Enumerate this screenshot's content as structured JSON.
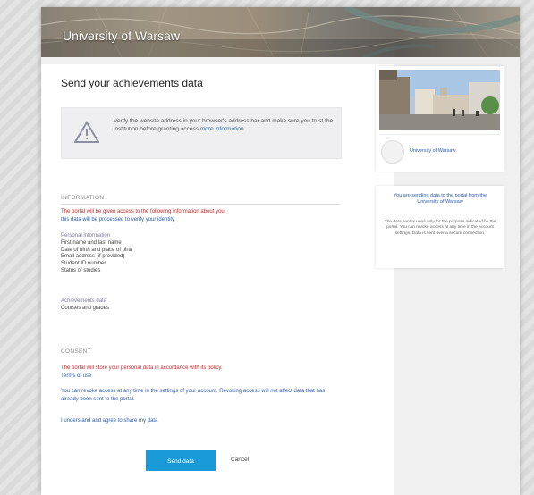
{
  "header": {
    "title": "University of Warsaw"
  },
  "main": {
    "title": "Send your achievements data",
    "warning": {
      "text": "Verify the website address in your browser's address bar and make sure you trust the institution before granting access",
      "link": "more information"
    },
    "section_info": {
      "heading": "INFORMATION",
      "paragraph_red": "The portal will be given access to the following information about you:",
      "paragraph_blue": "this data will be processed to verify your identity",
      "personal_label": "Personal information",
      "personal_items": [
        "First name and last name",
        "Date of birth and place of birth",
        "Email address (if provided)",
        "Student ID number",
        "Status of studies"
      ],
      "achievements_label": "Achievements data",
      "achievements_items": [
        "Courses and grades"
      ]
    },
    "section_consent": {
      "heading": "CONSENT",
      "paragraph_red": "The portal will store your personal data in accordance with its policy.",
      "paragraph_red2": "Terms of use",
      "paragraph_body": "You can revoke access at any time in the settings of your account. Revoking access will not affect data that has already been sent to the portal.",
      "checkbox_text": "I understand and agree to share my data"
    },
    "buttons": {
      "primary": "Send data",
      "secondary": "Cancel"
    }
  },
  "sidebar": {
    "card1": {
      "label": "University of Warsaw"
    },
    "card2": {
      "title": "You are sending data to the portal from the University of Warsaw",
      "text": "The data sent is used only for the purpose indicated by the portal. You can revoke access at any time in the account settings. Data is sent over a secure connection."
    }
  },
  "colors": {
    "accent": "#1a9ad6",
    "link": "#2a5db0",
    "warning": "#c62828"
  }
}
